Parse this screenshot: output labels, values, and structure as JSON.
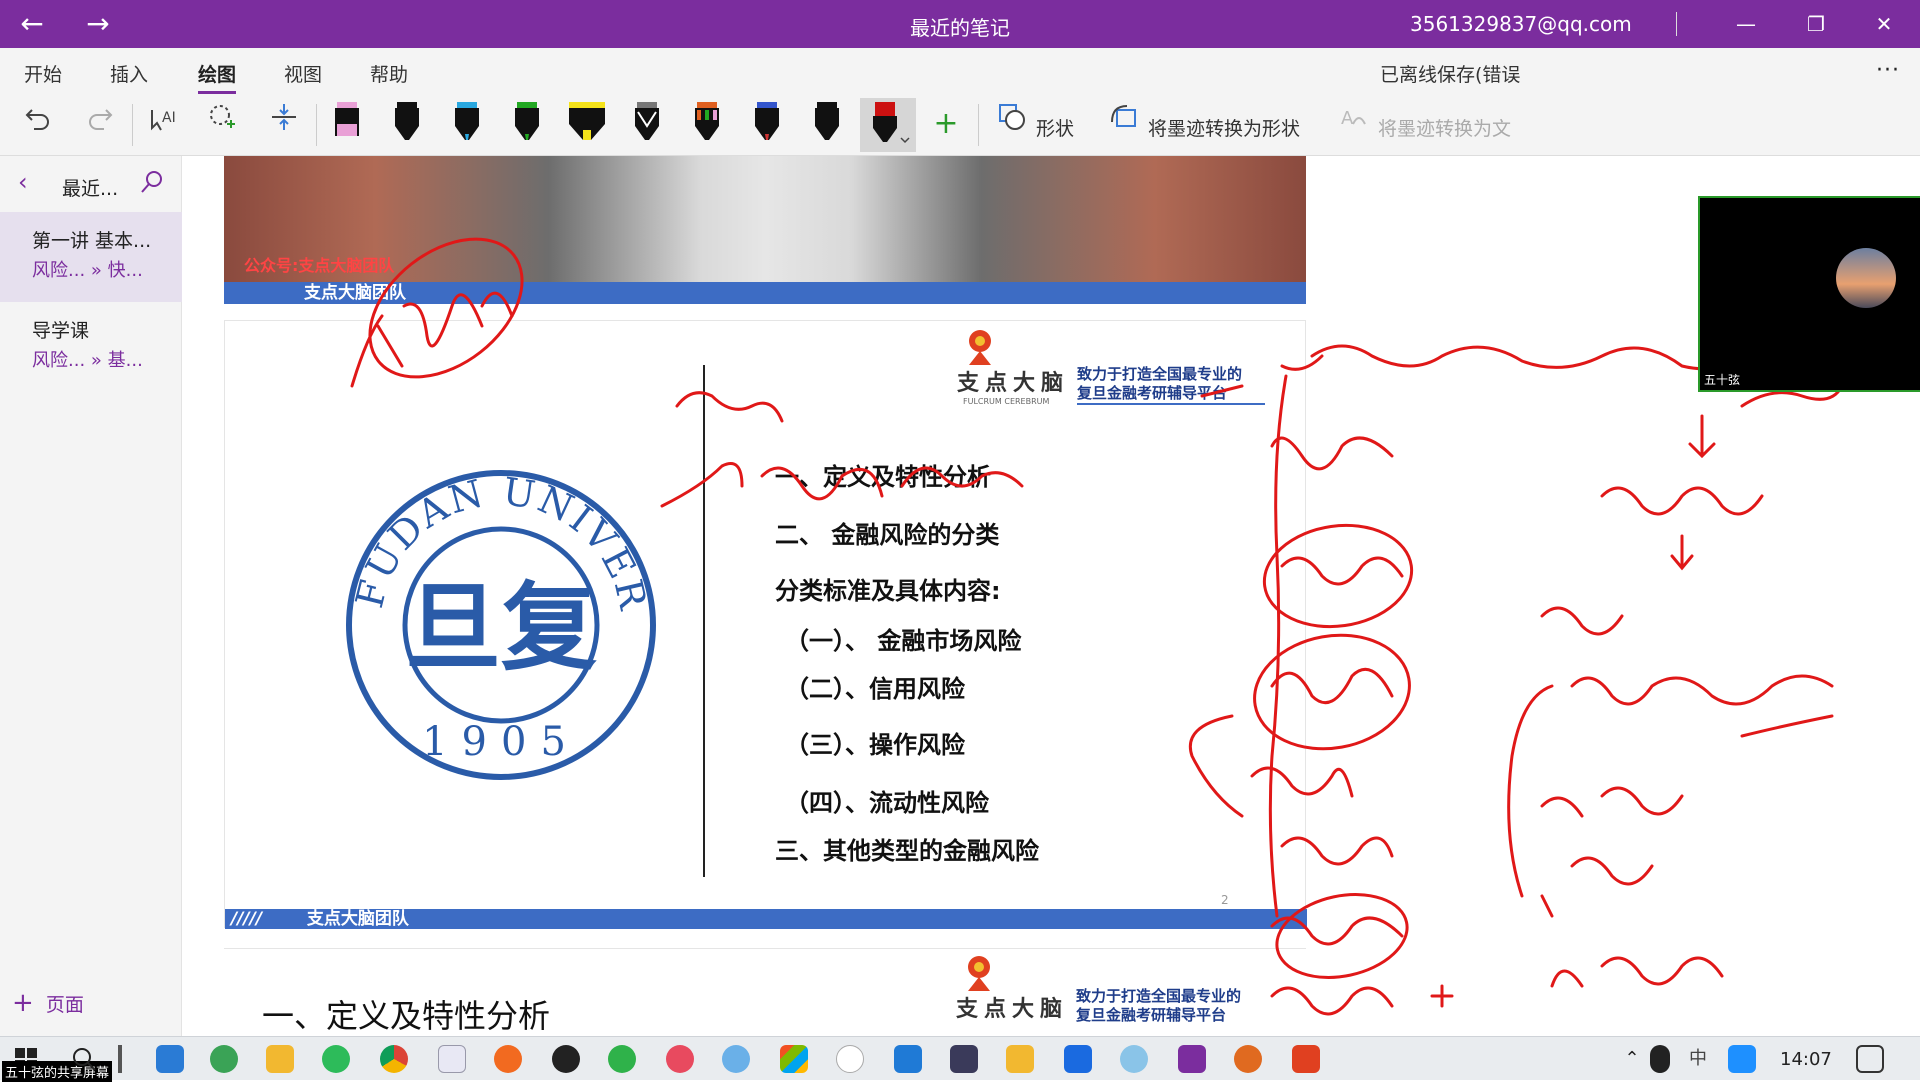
{
  "titlebar": {
    "title": "最近的笔记",
    "account": "3561329837@qq.com",
    "back": "←",
    "forward": "→",
    "minimize": "—",
    "restore": "❐",
    "close": "✕"
  },
  "tabs": {
    "items": [
      "开始",
      "插入",
      "绘图",
      "视图",
      "帮助"
    ],
    "active": "绘图",
    "save_status": "已离线保存(错误",
    "more": "···"
  },
  "toolbar": {
    "shapes_label": "形状",
    "ink_to_shape_label": "将墨迹转换为形状",
    "ink_to_text_label": "将墨迹转换为文",
    "pen_colors": [
      "#e9a0d6",
      "#111111",
      "#29a8e0",
      "#22a822",
      "#f5e31a",
      "#777777",
      "#e06020",
      "#3355cc",
      "#111111",
      "#cc1111"
    ],
    "accent": "#7b2d9e"
  },
  "sidebar": {
    "header": "最近...",
    "items": [
      {
        "title": "第一讲 基本...",
        "sub": "风险... » 快..."
      },
      {
        "title": "导学课",
        "sub": "风险... » 基..."
      }
    ],
    "add_page": "页面"
  },
  "slides": {
    "top_banner_text": "公众号:支点大脑团队",
    "footer_label": "支点大脑团队",
    "brand_name": "支点大脑",
    "brand_en": "FULCRUM CEREBRUM",
    "slogan_1": "致力于打造全国最专业的",
    "slogan_2": "复旦金融考研辅导平台",
    "logo_text": "FUDAN UNIVERSITY",
    "logo_year": "1905",
    "logo_char": "旦复",
    "outline": [
      "一、定义及特性分析",
      "二、 金融风险的分类",
      "分类标准及具体内容:",
      "（一）、 金融市场风险",
      "（二）、信用风险",
      "（三）、操作风险",
      "（四）、流动性风险",
      "三、其他类型的金融风险"
    ],
    "page_number": "2",
    "next_heading": "一、定义及特性分析"
  },
  "video": {
    "name": "五十弦"
  },
  "taskbar": {
    "share_label": "五十弦的共享屏幕",
    "time": "14:07",
    "ime": "中"
  }
}
